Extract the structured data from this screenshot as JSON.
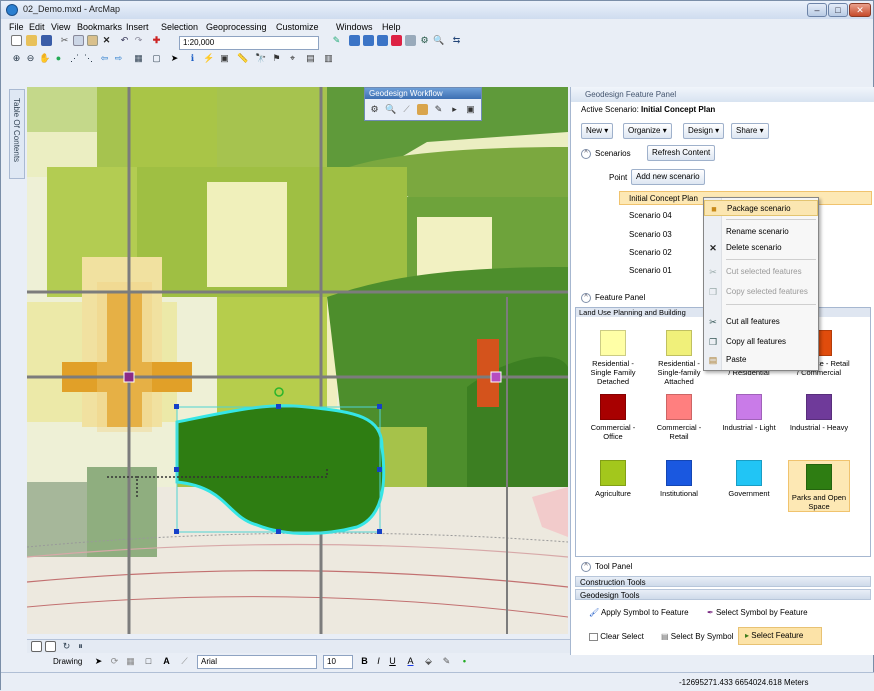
{
  "window": {
    "title": "02_Demo.mxd - ArcMap"
  },
  "menu": [
    "File",
    "Edit",
    "View",
    "Bookmarks",
    "Insert",
    "Selection",
    "Geoprocessing",
    "Customize",
    "Windows",
    "Help"
  ],
  "toolbar": {
    "scale": "1:20,000"
  },
  "toc": {
    "label": "Table Of Contents"
  },
  "workflow": {
    "title": "Geodesign Workflow"
  },
  "panel": {
    "title": "Geodesign Feature Panel",
    "active_label": "Active Scenario:",
    "active_value": "Initial Concept Plan",
    "buttons": {
      "new": "New",
      "organize": "Organize",
      "design": "Design",
      "share": "Share"
    },
    "scenarios": {
      "header": "Scenarios",
      "refresh": "Refresh Content",
      "point_label": "Point",
      "add_new": "Add new scenario",
      "items": [
        "Initial Concept Plan",
        "Scenario 04",
        "Scenario 03",
        "Scenario 02",
        "Scenario 01"
      ]
    },
    "context_menu": {
      "items": [
        {
          "label": "Package scenario",
          "icon": "package-icon"
        },
        {
          "label": "Rename scenario",
          "icon": "none"
        },
        {
          "label": "Delete scenario",
          "icon": "delete-icon"
        },
        {
          "label": "Cut selected features",
          "icon": "cut-icon"
        },
        {
          "label": "Copy selected features",
          "icon": "copy-icon"
        },
        {
          "label": "Cut all features",
          "icon": "cut-icon"
        },
        {
          "label": "Copy all features",
          "icon": "copy-icon"
        },
        {
          "label": "Paste",
          "icon": "paste-icon"
        }
      ]
    },
    "feature_panel": {
      "header": "Feature Panel",
      "group": "Land Use Planning and Building",
      "features": [
        {
          "label": "Residential - Single Family Detached",
          "color": "#ffffa6"
        },
        {
          "label": "Residential - Single-family Attached",
          "color": "#f0f07a"
        },
        {
          "label": "Mixed Use - Retail / Residential",
          "color": "#f2b450"
        },
        {
          "label": "Mixed Use - Retail / Commercial",
          "color": "#e04c0c"
        },
        {
          "label": "Commercial - Office",
          "color": "#a80000"
        },
        {
          "label": "Commercial - Retail",
          "color": "#ff7f7f"
        },
        {
          "label": "Industrial - Light",
          "color": "#c97be8"
        },
        {
          "label": "Industrial - Heavy",
          "color": "#6f3a9a"
        },
        {
          "label": "Agriculture",
          "color": "#a3c71c"
        },
        {
          "label": "Institutional",
          "color": "#1a58e0"
        },
        {
          "label": "Government",
          "color": "#21c5f5"
        },
        {
          "label": "Parks and Open Space",
          "color": "#2e7d12"
        }
      ]
    },
    "tool_panel": {
      "header": "Tool Panel",
      "construction": "Construction Tools",
      "geodesign": "Geodesign Tools",
      "apply_symbol": "Apply Symbol to Feature",
      "select_symbol_by_feature": "Select Symbol by Feature",
      "clear_select": "Clear Select",
      "select_by_symbol": "Select By Symbol",
      "select_feature": "Select Feature"
    }
  },
  "drawing": {
    "label": "Drawing",
    "font": "Arial",
    "size": "10"
  },
  "status": {
    "coords": "-12695271.433 6654024.618 Meters"
  }
}
